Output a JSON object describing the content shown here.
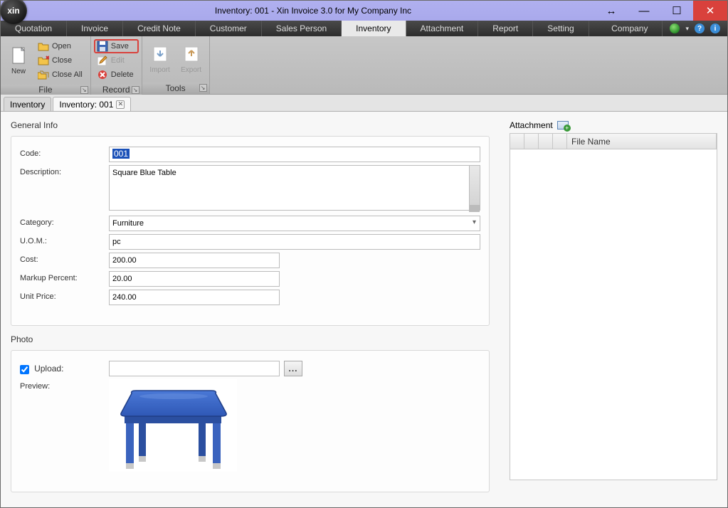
{
  "titlebar": {
    "title": "Inventory: 001 - Xin Invoice 3.0 for My Company Inc",
    "app_logo_text": "xin"
  },
  "menubar": {
    "items": [
      "Quotation",
      "Invoice",
      "Credit Note",
      "Customer",
      "Sales Person",
      "Inventory",
      "Attachment",
      "Report",
      "Setting"
    ],
    "active_index": 5,
    "right": {
      "company": "Company"
    }
  },
  "ribbon": {
    "file": {
      "label": "File",
      "new": "New",
      "open": "Open",
      "close": "Close",
      "close_all": "Close All"
    },
    "record": {
      "label": "Record",
      "save": "Save",
      "edit": "Edit",
      "delete": "Delete"
    },
    "tools": {
      "label": "Tools",
      "import": "Import",
      "export": "Export"
    }
  },
  "tabs": [
    {
      "label": "Inventory",
      "closable": false,
      "active": false
    },
    {
      "label": "Inventory: 001",
      "closable": true,
      "active": true
    }
  ],
  "general_info": {
    "title": "General Info",
    "labels": {
      "code": "Code:",
      "description": "Description:",
      "category": "Category:",
      "uom": "U.O.M.:",
      "cost": "Cost:",
      "markup": "Markup Percent:",
      "unit_price": "Unit Price:"
    },
    "values": {
      "code": "001",
      "description": "Square Blue Table",
      "category": "Furniture",
      "uom": "pc",
      "cost": "200.00",
      "markup": "20.00",
      "unit_price": "240.00"
    }
  },
  "photo": {
    "title": "Photo",
    "upload_label": "Upload:",
    "preview_label": "Preview:",
    "upload_checked": true,
    "upload_path": "",
    "browse_label": "..."
  },
  "attachment": {
    "title": "Attachment",
    "columns": {
      "file_name": "File Name"
    },
    "rows": []
  }
}
